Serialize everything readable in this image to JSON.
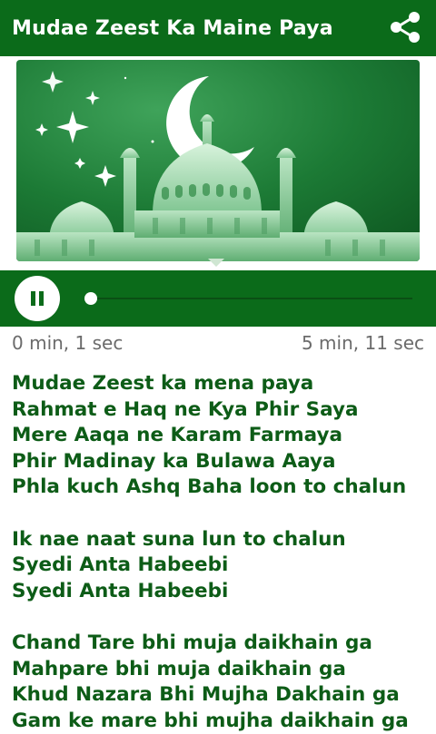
{
  "app_bar": {
    "title": "Mudae Zeest Ka Maine Paya",
    "share_icon": "share-icon"
  },
  "banner": {
    "image": "mosque-crescent-night-illustration"
  },
  "player": {
    "state": "playing",
    "pause_icon": "pause-icon",
    "progress": 0.003,
    "elapsed": "0 min, 1 sec",
    "total": "5 min, 11 sec"
  },
  "lyrics": {
    "stanza1": [
      "Mudae Zeest ka mena paya",
      "Rahmat e Haq ne Kya Phir Saya",
      "Mere Aaqa ne Karam Farmaya",
      "Phir Madinay ka Bulawa Aaya",
      "Phla kuch Ashq Baha loon to chalun"
    ],
    "stanza2": [
      "Ik nae naat suna lun to chalun",
      "Syedi Anta Habeebi",
      "Syedi Anta Habeebi"
    ],
    "stanza3": [
      "Chand Tare bhi muja daikhain ga",
      "Mahpare bhi muja daikhain ga",
      "Khud Nazara Bhi Mujha Dakhain ga",
      "Gam ke mare bhi mujha daikhain ga"
    ]
  },
  "colors": {
    "primary": "#0b6b1a",
    "lyrics_text": "#0d5c17",
    "time_text": "#6b6b6b"
  }
}
